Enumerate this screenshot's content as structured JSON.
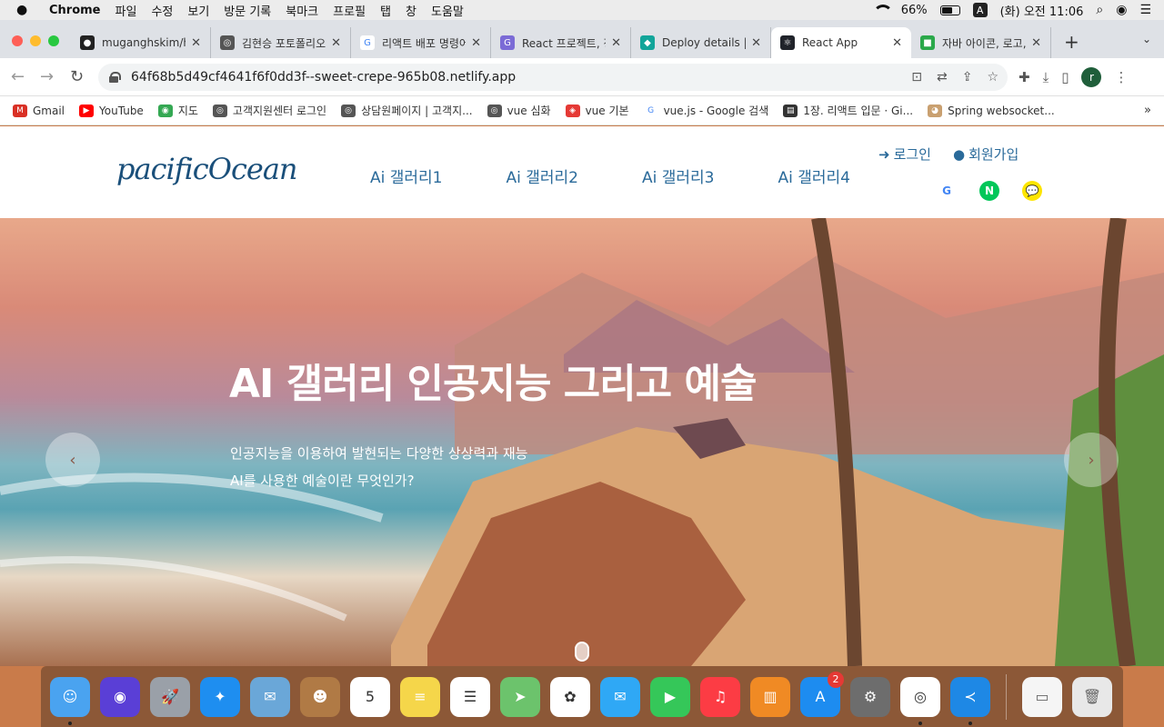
{
  "menubar": {
    "app": "Chrome",
    "items": [
      "파일",
      "수정",
      "보기",
      "방문 기록",
      "북마크",
      "프로필",
      "탭",
      "창",
      "도움말"
    ],
    "battery_percent_text": "66%",
    "battery_level": 0.66,
    "input_method": "A",
    "clock": "(화) 오전 11:06"
  },
  "tabs": [
    {
      "title": "muganghskim/h",
      "fav_color": "#222222",
      "fav_glyph": "●"
    },
    {
      "title": "김현승 포토폴리오",
      "fav_color": "#555555",
      "fav_glyph": "◎"
    },
    {
      "title": "리액트 배포 명령어",
      "fav_color": "#ffffff",
      "fav_glyph": "G"
    },
    {
      "title": "React 프로젝트, 정",
      "fav_color": "#7b6bd6",
      "fav_glyph": "G"
    },
    {
      "title": "Deploy details |",
      "fav_color": "#12a59a",
      "fav_glyph": "◆"
    },
    {
      "title": "React App",
      "fav_color": "#20232a",
      "fav_glyph": "⚛"
    },
    {
      "title": "자바 아이콘, 로고,",
      "fav_color": "#2aa84a",
      "fav_glyph": "■"
    }
  ],
  "toolbar": {
    "url": "64f68b5d49cf4641f6f0dd3f--sweet-crepe-965b08.netlify.app",
    "profile_initial": "r"
  },
  "bookmarks": [
    {
      "label": "Gmail",
      "color": "#d93025",
      "glyph": "M"
    },
    {
      "label": "YouTube",
      "color": "#ff0000",
      "glyph": "▶"
    },
    {
      "label": "지도",
      "color": "#34a853",
      "glyph": "◉"
    },
    {
      "label": "고객지원센터 로그인",
      "color": "#555555",
      "glyph": "◎"
    },
    {
      "label": "상담원페이지 | 고객지...",
      "color": "#555555",
      "glyph": "◎"
    },
    {
      "label": "vue 심화",
      "color": "#555555",
      "glyph": "◎"
    },
    {
      "label": "vue 기본",
      "color": "#e53935",
      "glyph": "◈"
    },
    {
      "label": "vue.js - Google 검색",
      "color": "#ffffff",
      "glyph": "G"
    },
    {
      "label": "1장. 리액트 입문 · Gi...",
      "color": "#333333",
      "glyph": "▤"
    },
    {
      "label": "Spring websocket...",
      "color": "#c9a070",
      "glyph": "◕"
    }
  ],
  "site": {
    "logo": "pacificOcean",
    "nav": [
      "Ai 갤러리1",
      "Ai 갤러리2",
      "Ai 갤러리3",
      "Ai 갤러리4"
    ],
    "login": "로그인",
    "signup": "회원가입",
    "social": [
      {
        "name": "google",
        "glyph": "G",
        "bg": "#ffffff",
        "fg": "#4285f4"
      },
      {
        "name": "naver",
        "glyph": "N",
        "bg": "#03c75a",
        "fg": "#ffffff"
      },
      {
        "name": "kakao",
        "glyph": "💬",
        "bg": "#fee500",
        "fg": "#3c1e1e"
      }
    ]
  },
  "hero": {
    "title": "AI 갤러리 인공지능 그리고 예술",
    "sub1": "인공지능을 이용하여 발현되는 다양한 상상력과 재능",
    "sub2": "AI를 사용한 예술이란 무엇인가?",
    "prev": "‹",
    "next": "›"
  },
  "dock": [
    {
      "name": "finder",
      "bg": "#4aa3f0",
      "glyph": "☺",
      "running": true
    },
    {
      "name": "siri",
      "bg": "#5a3fd6",
      "glyph": "◉",
      "running": false
    },
    {
      "name": "launchpad",
      "bg": "#9aa0a8",
      "glyph": "🚀",
      "running": false
    },
    {
      "name": "safari",
      "bg": "#1e8ef0",
      "glyph": "✦",
      "running": false
    },
    {
      "name": "mail-bird",
      "bg": "#6aa7d8",
      "glyph": "✉",
      "running": false
    },
    {
      "name": "contacts",
      "bg": "#b07a45",
      "glyph": "☻",
      "running": false
    },
    {
      "name": "calendar",
      "bg": "#ffffff",
      "glyph": "5",
      "running": false
    },
    {
      "name": "notes",
      "bg": "#f5d64a",
      "glyph": "≡",
      "running": false
    },
    {
      "name": "reminders",
      "bg": "#ffffff",
      "glyph": "☰",
      "running": false
    },
    {
      "name": "maps",
      "bg": "#6cc36c",
      "glyph": "➤",
      "running": false
    },
    {
      "name": "photos",
      "bg": "#ffffff",
      "glyph": "✿",
      "running": false
    },
    {
      "name": "messages",
      "bg": "#2fa8f5",
      "glyph": "✉",
      "running": false
    },
    {
      "name": "facetime",
      "bg": "#35c759",
      "glyph": "▶",
      "running": false
    },
    {
      "name": "music",
      "bg": "#fc3c44",
      "glyph": "♫",
      "running": false
    },
    {
      "name": "books",
      "bg": "#f08a24",
      "glyph": "▥",
      "running": false
    },
    {
      "name": "app-store",
      "bg": "#1d8cf0",
      "glyph": "A",
      "running": false,
      "badge": "2"
    },
    {
      "name": "system-preferences",
      "bg": "#6d6d6d",
      "glyph": "⚙",
      "running": false
    },
    {
      "name": "chrome",
      "bg": "#ffffff",
      "glyph": "◎",
      "running": true
    },
    {
      "name": "vscode",
      "bg": "#1e88e5",
      "glyph": "≺",
      "running": true
    }
  ],
  "dock_right": [
    {
      "name": "downloads-stack",
      "bg": "#f5f5f5",
      "glyph": "▭"
    },
    {
      "name": "trash",
      "bg": "#e8e8e8",
      "glyph": "🗑"
    }
  ]
}
